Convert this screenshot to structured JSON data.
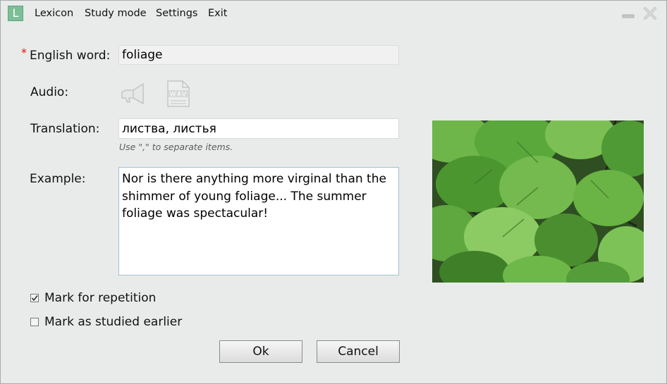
{
  "app": {
    "logo_letter": "L"
  },
  "menu": {
    "items": [
      "Lexicon",
      "Study mode",
      "Settings",
      "Exit"
    ]
  },
  "form": {
    "required_marker": "*",
    "english_word_label": "English word:",
    "english_word_value": "foliage",
    "audio_label": "Audio:",
    "audio_icons": [
      "speaker-icon",
      "wav-file-icon"
    ],
    "translation_label": "Translation:",
    "translation_value": "листва, листья",
    "translation_hint": "Use \",\" to separate items.",
    "example_label": "Example:",
    "example_value": "Nor is there anything more virginal than the shimmer of young foliage... The summer foliage was spectacular!"
  },
  "options": {
    "mark_repetition_label": "Mark for repetition",
    "mark_repetition_checked": true,
    "mark_studied_label": "Mark as studied earlier",
    "mark_studied_checked": false
  },
  "buttons": {
    "ok_label": "Ok",
    "cancel_label": "Cancel"
  },
  "colors": {
    "background": "#e9ebea",
    "logo": "#7cbf96",
    "required": "#dd1111",
    "leaf_green": "#5aa83c"
  }
}
